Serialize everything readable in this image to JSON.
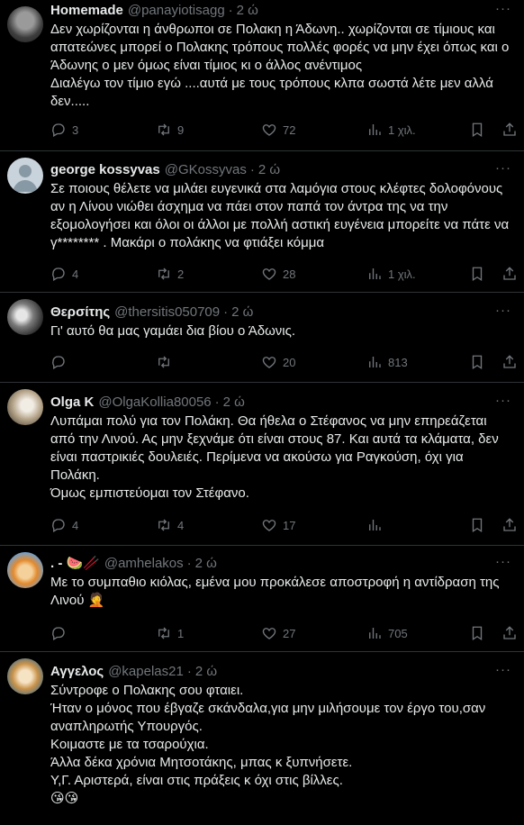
{
  "stat_icons": [
    "reply-icon",
    "retweet-icon",
    "like-icon",
    "views-icon",
    "bookmark-icon",
    "share-icon"
  ],
  "tweets": [
    {
      "name": "Homemade",
      "handle": "@panayiotisagg",
      "time": "2 ώ",
      "text": "Δεν χωρίζονται η άνθρωποι σε Πολακη η Άδωνη.. χωρίζονται σε τίμιους και απατεώνες μπορεί ο Πολακης τρόπους πολλές φορές να μην έχει όπως και ο Άδωνης ο μεν όμως είναι τίμιος κι ο άλλος ανέντιμος\nΔιαλέγω τον τίμιο εγώ ....αυτά με τους τρόπους κλπα σωστά λέτε μεν αλλά δεν.....",
      "replies": "3",
      "retweets": "9",
      "likes": "72",
      "views": "1 χιλ."
    },
    {
      "name": "george kossyvas",
      "handle": "@GKossyvas",
      "time": "2 ώ",
      "text": "Σε ποιους θέλετε να μιλάει ευγενικά στα λαμόγια στους κλέφτες δολοφόνους αν η Λίνου νιώθει άσχημα να πάει στον παπά τον άντρα της να την εξομολογήσει και όλοι οι άλλοι με πολλή αστική ευγένεια μπορείτε να πάτε να γ******** . Μακάρι ο πολάκης να φτιάξει κόμμα",
      "replies": "4",
      "retweets": "2",
      "likes": "28",
      "views": "1 χιλ."
    },
    {
      "name": "Θερσίτης",
      "handle": "@thersitis050709",
      "time": "2 ώ",
      "text": "Γι' αυτό θα μας γαμάει δια βίου ο Άδωνις.",
      "replies": "",
      "retweets": "",
      "likes": "20",
      "views": "813"
    },
    {
      "name": "Olga K",
      "handle": "@OlgaKollia80056",
      "time": "2 ώ",
      "text": "Λυπάμαι πολύ για τον Πολάκη. Θα ήθελα ο Στέφανος να μην επηρεάζεται από την Λινού. Ας μην ξεχνάμε ότι είναι στους 87. Και αυτά τα κλάματα, δεν είναι παστρικιές δουλειές. Περίμενα να ακούσω για Ραγκούση, όχι για Πολάκη.\nΌμως εμπιστεύομαι τον Στέφανο.",
      "replies": "4",
      "retweets": "4",
      "likes": "17",
      "views": ""
    },
    {
      "name": ". - 🍉🥢",
      "handle": "@amhelakos",
      "time": "2 ώ",
      "text": "Με το συμπαθιο κιόλας, εμένα μου προκάλεσε αποστροφή η αντίδραση της Λινού 🤦",
      "replies": "",
      "retweets": "1",
      "likes": "27",
      "views": "705"
    },
    {
      "name": "Αγγελος",
      "handle": "@kapelas21",
      "time": "2 ώ",
      "text": "Σύντροφε ο Πολακης σου φταιει.\nΉταν ο μόνος που έβγαζε σκάνδαλα,για μην μιλήσουμε τον έργο του,σαν αναπληρωτής Υπουργός.\nΚοιμαστε με τα τσαρούχια.\nΆλλα δέκα χρόνια Μητσοτάκης, μπας κ ξυπνήσετε.\nΥ,Γ. Αριστερά, είναι στις πράξεις κ όχι στις βίλλες.\n😘😘",
      "replies": "",
      "retweets": "",
      "likes": "",
      "views": ""
    }
  ]
}
